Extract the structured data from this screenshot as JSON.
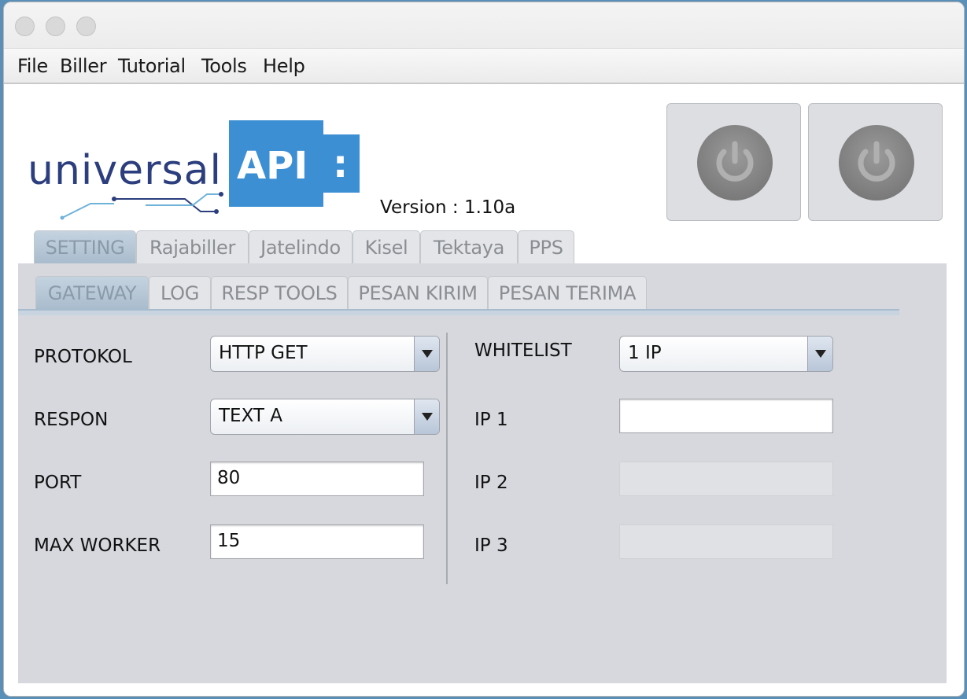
{
  "menubar": {
    "items": [
      "File",
      "Biller",
      "Tutorial",
      "Tools",
      "Help"
    ]
  },
  "logo": {
    "brand": "universal",
    "api": "API",
    "colon": ":"
  },
  "version": "Version : 1.10a",
  "main_tabs": [
    "SETTING",
    "Rajabiller",
    "Jatelindo",
    "Kisel",
    "Tektaya",
    "PPS"
  ],
  "sub_tabs": [
    "GATEWAY",
    "LOG",
    "RESP TOOLS",
    "PESAN KIRIM",
    "PESAN TERIMA"
  ],
  "form": {
    "protokol_label": "PROTOKOL",
    "protokol_value": "HTTP GET",
    "respon_label": "RESPON",
    "respon_value": "TEXT A",
    "port_label": "PORT",
    "port_value": "80",
    "max_worker_label": "MAX WORKER",
    "max_worker_value": "15",
    "whitelist_label": "WHITELIST",
    "whitelist_value": "1 IP",
    "ip1_label": "IP 1",
    "ip1_value": "",
    "ip2_label": "IP 2",
    "ip2_value": "",
    "ip3_label": "IP 3",
    "ip3_value": ""
  },
  "colors": {
    "logo_blue": "#3d8fd4",
    "logo_text": "#2c3e7d",
    "panel_bg": "#d6d8dd",
    "active_tab": "#b4c5d6"
  }
}
